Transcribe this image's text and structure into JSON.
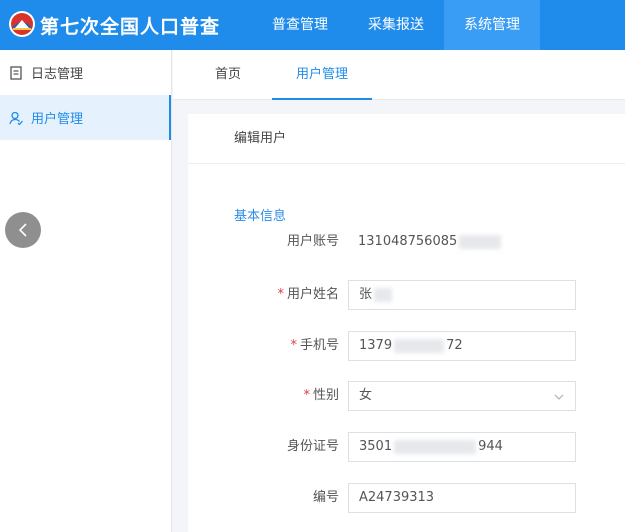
{
  "app": {
    "title": "第七次全国人口普查"
  },
  "top_nav": [
    {
      "label": "普查管理"
    },
    {
      "label": "采集报送"
    },
    {
      "label": "系统管理"
    }
  ],
  "sidebar": {
    "items": [
      {
        "label": "日志管理",
        "icon": "log-document-icon"
      },
      {
        "label": "用户管理",
        "icon": "user-icon"
      }
    ]
  },
  "tabs": [
    {
      "label": "首页"
    },
    {
      "label": "用户管理"
    }
  ],
  "card": {
    "title": "编辑用户",
    "section": "基本信息",
    "fields": {
      "account": {
        "label": "用户账号",
        "value": "131048756085"
      },
      "name": {
        "label": "用户姓名",
        "value": "张"
      },
      "phone": {
        "label": "手机号",
        "value_start": "1379",
        "value_end": "72"
      },
      "gender": {
        "label": "性别",
        "value": "女"
      },
      "idcard": {
        "label": "身份证号",
        "value_start": "3501",
        "value_end": "944"
      },
      "code": {
        "label": "编号",
        "value": "A24739313"
      }
    }
  },
  "colors": {
    "brand": "#1f8ceb",
    "required": "#e03c3c"
  }
}
